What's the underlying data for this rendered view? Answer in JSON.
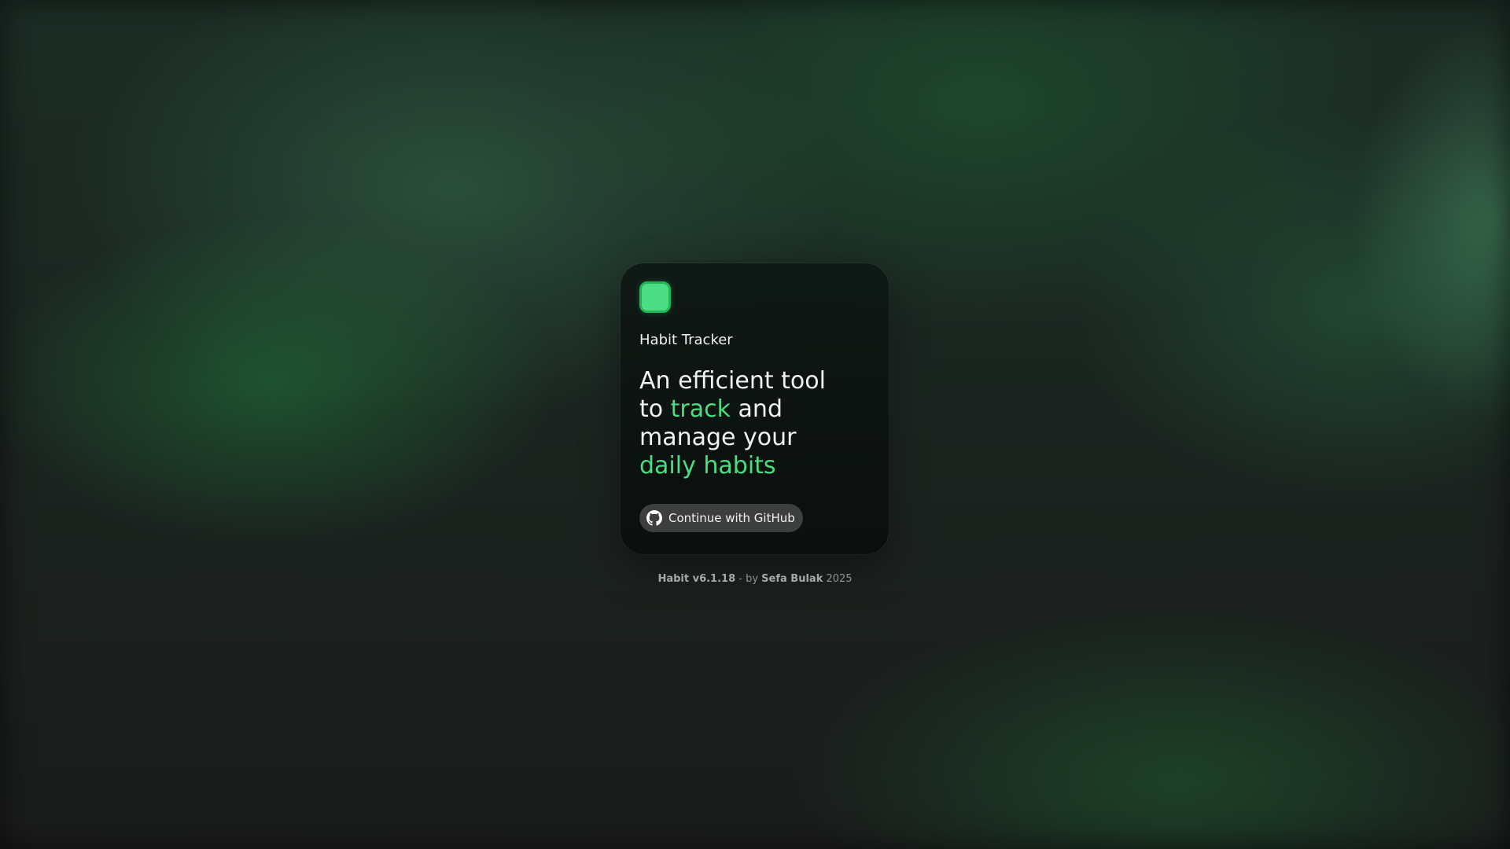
{
  "app": {
    "name": "Habit Tracker"
  },
  "headline": {
    "line1": "An efficient tool",
    "line2_prefix": "to ",
    "line2_accent": "track",
    "line2_suffix": " and",
    "line3": "manage your",
    "line4_accent": "daily habits"
  },
  "auth": {
    "github_label": "Continue with GitHub",
    "icon": "github-icon"
  },
  "footer": {
    "version": "Habit v6.1.18",
    "separator": " - by ",
    "author": "Sefa Bulak",
    "year": " 2025"
  },
  "colors": {
    "accent": "#4ade80",
    "logo_fill": "#4ddd86",
    "logo_border": "#20b454",
    "button_bg": "#3d3f3e"
  }
}
